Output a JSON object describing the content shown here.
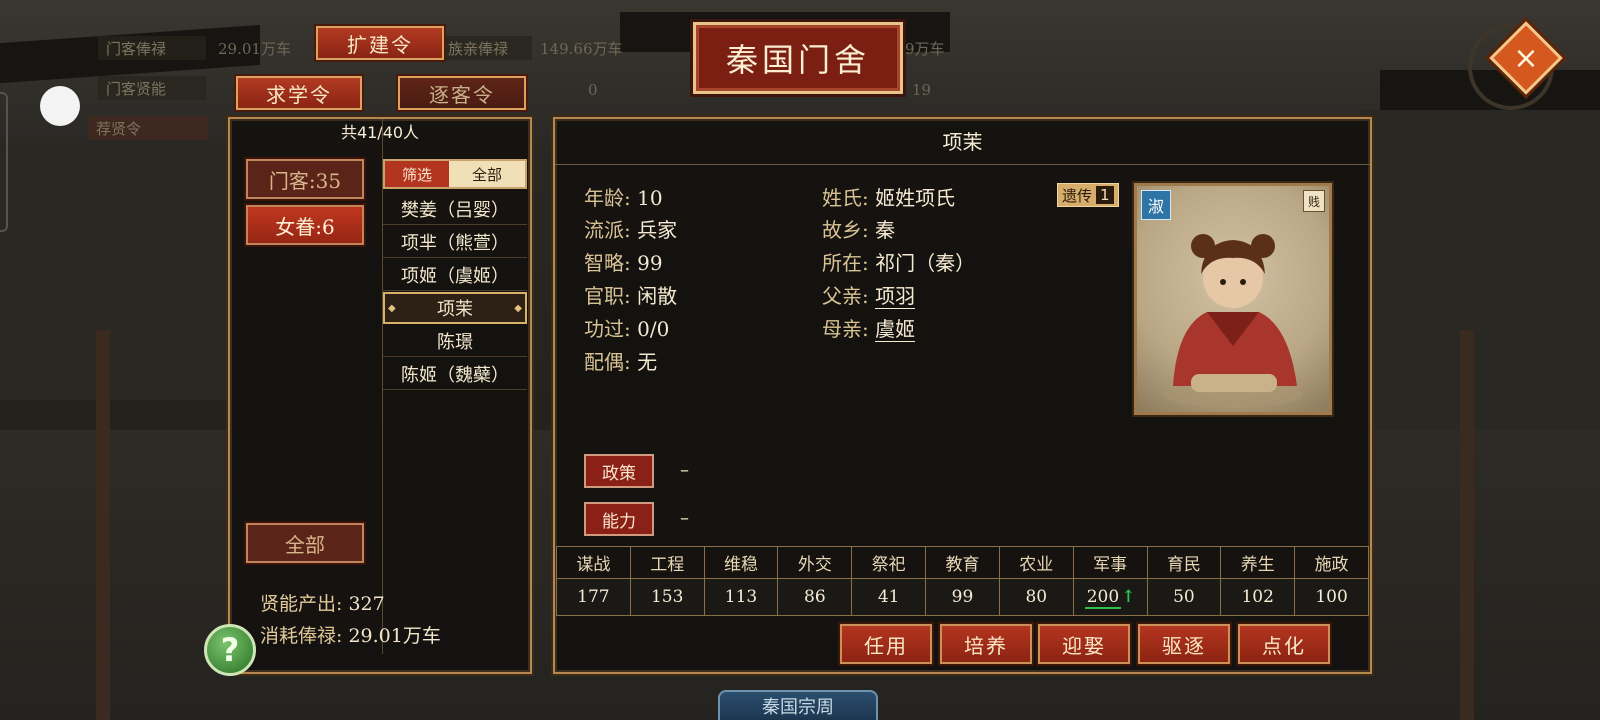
{
  "top_bar": {
    "guest_salary_label": "门客俸禄",
    "guest_salary_value": "29.01万车",
    "family_salary_label": "族亲俸禄",
    "family_salary_value": "149.66万车",
    "third_value": "9万车",
    "guest_talent_label": "门客贤能",
    "guest_talent_value": "0",
    "third_talent_value": "19",
    "recruit_label": "荐贤令"
  },
  "edicts": {
    "expand": "扩建令",
    "study": "求学令",
    "expel_guests": "逐客令"
  },
  "title": "秦国门舍",
  "close_icon": "×",
  "left_panel": {
    "count": "共41/40人",
    "cat_guests": "门客:35",
    "cat_women": "女眷:6",
    "cat_all": "全部",
    "filter_label": "筛选",
    "filter_value": "全部",
    "items": [
      "樊姜（吕婴）",
      "项芈（熊萱）",
      "项姬（虞姬）",
      "项茉",
      "陈璟",
      "陈姬（魏蘗）"
    ],
    "selected_index": 3,
    "talent_output_label": "贤能产出:",
    "talent_output_value": "327",
    "salary_cost_label": "消耗俸禄:",
    "salary_cost_value": "29.01万车"
  },
  "help_icon": "?",
  "detail": {
    "name": "项茉",
    "age_label": "年龄:",
    "age": "10",
    "school_label": "流派:",
    "school": "兵家",
    "wisdom_label": "智略:",
    "wisdom": "99",
    "office_label": "官职:",
    "office": "闲散",
    "merit_label": "功过:",
    "merit": "0/0",
    "spouse_label": "配偶:",
    "spouse": "无",
    "clan_label": "姓氏:",
    "clan": "姬姓项氏",
    "hometown_label": "故乡:",
    "hometown": "秦",
    "location_label": "所在:",
    "location": "祁门（秦）",
    "father_label": "父亲:",
    "father": "项羽",
    "mother_label": "母亲:",
    "mother": "虞姬",
    "heredity_label": "遗传",
    "heredity_value": "1",
    "portrait_badge": "淑",
    "portrait_corner": "贱",
    "policy_label": "政策",
    "policy_value": "–",
    "ability_label": "能力",
    "ability_value": "–"
  },
  "skills": {
    "headers": [
      "谋战",
      "工程",
      "维稳",
      "外交",
      "祭祀",
      "教育",
      "农业",
      "军事",
      "育民",
      "养生",
      "施政"
    ],
    "values": [
      "177",
      "153",
      "113",
      "86",
      "41",
      "99",
      "80",
      "200",
      "50",
      "102",
      "100"
    ],
    "up_arrow": "↑"
  },
  "actions": {
    "appoint": "任用",
    "cultivate": "培养",
    "marry": "迎娶",
    "expel": "驱逐",
    "enlighten": "点化"
  },
  "bottom_tab": "秦国宗周"
}
